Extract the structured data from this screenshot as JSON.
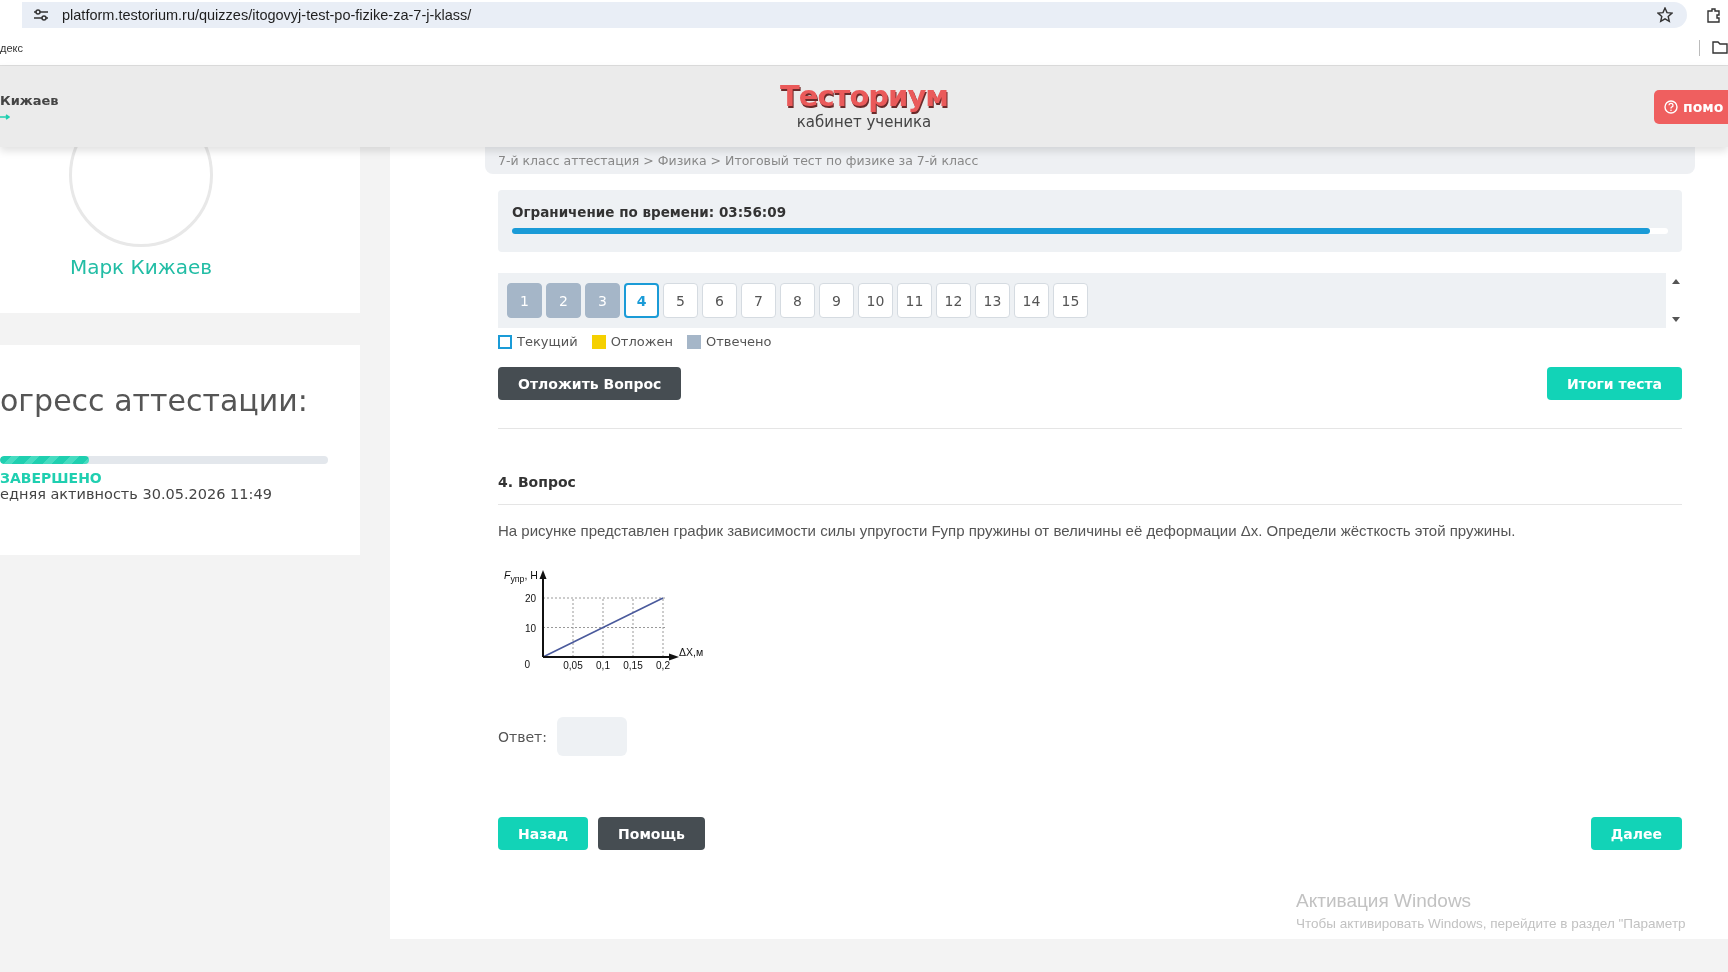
{
  "browser": {
    "url": "platform.testorium.ru/quizzes/itogovyj-test-po-fizike-za-7-j-klass/",
    "bookmarks": [
      "декс"
    ]
  },
  "header": {
    "user_name": "Кижаев",
    "logo": "Тесториум",
    "subtitle": "кабинет ученика",
    "help_button": "помо"
  },
  "profile": {
    "name": "Марк Кижаев"
  },
  "progress_card": {
    "title": "огресс аттестации:",
    "level": 0.27,
    "status": "ЗАВЕРШЕНО",
    "last_activity": "едняя активность 30.05.2026 11:49"
  },
  "breadcrumb": "7-й класс аттестация > Физика > Итоговый тест по физике за 7-й класс",
  "timer": {
    "label": "Ограничение по времени: 03:56:09",
    "level": 0.984
  },
  "questions": [
    {
      "label": "1",
      "answered": true,
      "selected": false
    },
    {
      "label": "2",
      "answered": true,
      "selected": false
    },
    {
      "label": "3",
      "answered": true,
      "selected": false
    },
    {
      "label": "4",
      "answered": false,
      "selected": true
    },
    {
      "label": "5",
      "answered": false,
      "selected": false
    },
    {
      "label": "6",
      "answered": false,
      "selected": false
    },
    {
      "label": "7",
      "answered": false,
      "selected": false
    },
    {
      "label": "8",
      "answered": false,
      "selected": false
    },
    {
      "label": "9",
      "answered": false,
      "selected": false
    },
    {
      "label": "10",
      "answered": false,
      "selected": false
    },
    {
      "label": "11",
      "answered": false,
      "selected": false
    },
    {
      "label": "12",
      "answered": false,
      "selected": false
    },
    {
      "label": "13",
      "answered": false,
      "selected": false
    },
    {
      "label": "14",
      "answered": false,
      "selected": false
    },
    {
      "label": "15",
      "answered": false,
      "selected": false
    }
  ],
  "legend": [
    {
      "label": "Текущий",
      "kind": "outline",
      "color": "#1a9bd7"
    },
    {
      "label": "Отложен",
      "kind": "fill",
      "color": "#f5d000"
    },
    {
      "label": "Отвечено",
      "kind": "fill",
      "color": "#a5b6c8"
    }
  ],
  "actions": {
    "postpone_button": "Отложить Вопрос",
    "results_button": "Итоги теста"
  },
  "question": {
    "title": "4. Вопрос",
    "text": "На рисунке представлен график зависимости силы упругости Fупр пружины от величины её деформации Δx. Определи жёсткость этой пружины.",
    "chart_data": {
      "type": "line",
      "grid": true,
      "xlabel": "ΔX,м",
      "ylabel": "*F*$_{упр}$, Н",
      "x": [
        0,
        0.05,
        0.1,
        0.15,
        0.2
      ],
      "series": [
        {
          "color": "#4a5a9c",
          "values": [
            0,
            5,
            10,
            15,
            20
          ]
        }
      ],
      "xlim": [
        0,
        0.2
      ],
      "ylim": [
        0,
        20
      ],
      "xticks": [
        {
          "value": 0.05,
          "label": "0,05"
        },
        {
          "value": 0.1,
          "label": "0,1"
        },
        {
          "value": 0.15,
          "label": "0,15"
        },
        {
          "value": 0.2,
          "label": "0,2"
        }
      ],
      "yticks": [
        {
          "value": 0,
          "label": "0"
        },
        {
          "value": 10,
          "label": "10"
        },
        {
          "value": 20,
          "label": "20"
        }
      ]
    },
    "answer_label": "Ответ:"
  },
  "navigation": {
    "back_button": "Назад",
    "help_button": "Помощь",
    "next_button": "Далее"
  },
  "os_notice": {
    "title": "Активация Windows",
    "text": "Чтобы активировать Windows, перейдите в раздел \"Параметр"
  }
}
